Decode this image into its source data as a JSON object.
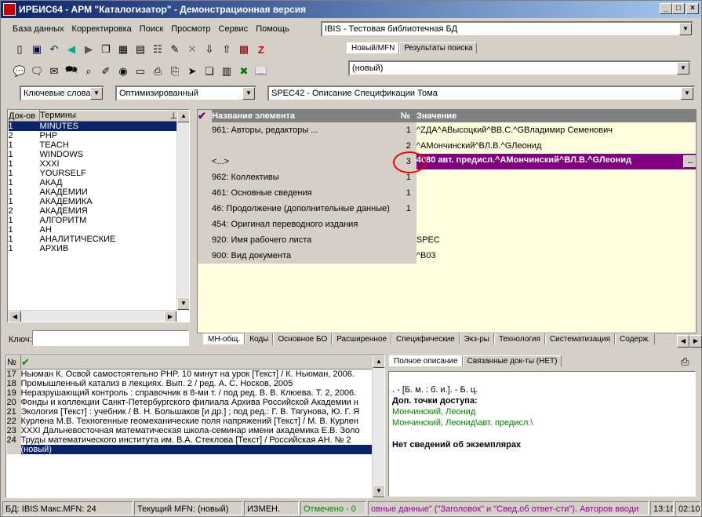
{
  "title": "ИРБИС64 - АРМ \"Каталогизатор\" - Демонстрационная версия",
  "menu": [
    "База данных",
    "Корректировка",
    "Поиск",
    "Просмотр",
    "Сервис",
    "Помощь"
  ],
  "db_combo": "IBIS - Тестовая библиотечная БД",
  "tabs_top": [
    "Новый/MFN",
    "Результаты поиска"
  ],
  "mfn_combo": "(новый)",
  "search_mode": "Ключевые слова",
  "search_opt": "Оптимизированный",
  "worksheet": "SPEC42 - Описание Спецификации Тома",
  "terms_headers": [
    "Док-ов",
    "Термины"
  ],
  "terms": [
    [
      "1",
      "MINUTES"
    ],
    [
      "2",
      "PHP"
    ],
    [
      "1",
      "TEACH"
    ],
    [
      "1",
      "WINDOWS"
    ],
    [
      "1",
      "XXXI"
    ],
    [
      "1",
      "YOURSELF"
    ],
    [
      "1",
      "АКАД"
    ],
    [
      "1",
      "АКАДЕМИИ"
    ],
    [
      "1",
      "АКАДЕМИКА"
    ],
    [
      "2",
      "АКАДЕМИЯ"
    ],
    [
      "1",
      "АЛГОРИТМ"
    ],
    [
      "1",
      "АН"
    ],
    [
      "1",
      "АНАЛИТИЧЕСКИЕ"
    ],
    [
      "1",
      "АРХИВ"
    ]
  ],
  "key_label": "Ключ:",
  "fields_headers": [
    "Название элемента",
    "№",
    "Значение"
  ],
  "fields": [
    [
      "961: Авторы, редакторы ...",
      "1",
      "^ZДА^AВысоцкий^BВ.С.^GВладимир Семенович"
    ],
    [
      "",
      "2",
      "^AМончинский^BЛ.В.^GЛеонид"
    ],
    [
      "<...>",
      "3",
      "4080 авт. предисл.^AМончинский^BЛ.В.^GЛеонид"
    ],
    [
      "962: Коллективы",
      "1",
      ""
    ],
    [
      "461: Основные сведения",
      "1",
      ""
    ],
    [
      "46: Продолжение (дополнительные данные)",
      "1",
      ""
    ],
    [
      "454: Оригинал переводного издания",
      "",
      ""
    ],
    [
      "920: Имя рабочего листа",
      "",
      "SPEC"
    ],
    [
      "900: Вид документа",
      "",
      "^B03"
    ]
  ],
  "bottom_tabs": [
    "МН-общ.",
    "Коды",
    "Основное БО",
    "Расширенное",
    "Специфические",
    "Экз-ры",
    "Технология",
    "Систематизация",
    "Содерж."
  ],
  "list_header": "№",
  "list": [
    [
      "17",
      "Ньюман К. Освой самостоятельно PHP. 10 минут на урок [Текст] / К. Ньюман, 2006."
    ],
    [
      "18",
      "Промышленный катализ в лекциях. Вып. 2 / ред. А. С. Носков, 2005"
    ],
    [
      "19",
      "Неразрушающий контроль : справочник в 8-ми т. / под ред. В. В. Клюева. Т. 2, 2006."
    ],
    [
      "20",
      "Фонды и коллекции Санкт-Петербургского филиала Архива Российской Академии н"
    ],
    [
      "21",
      "Экология [Текст] : учебник / В. Н. Большаков [и др.] ; под ред.: Г. В. Тягунова, Ю. Г. Я"
    ],
    [
      "22",
      "Курлена М.В. Техногенные геомеханические поля напряжений [Текст] / М. В. Курлен"
    ],
    [
      "23",
      "XXXI Дальневосточная математическая школа-семинар имени академика Е.В. Золо"
    ],
    [
      "24",
      "Труды математического института им. В.А. Стеклова [Текст] / Российская АН. № 2"
    ],
    [
      "",
      "(новый)"
    ]
  ],
  "desc_tabs": [
    "Полное описание",
    "Связанные док-ты (НЕТ)"
  ],
  "desc": {
    "l1": ". - [Б. м. : б. и.]. - Б. ц.",
    "l2": "Доп. точки доступа:",
    "l3": "Мончинский, Леонид",
    "l4": "Мончинский, Леонид\\авт. предисл.\\",
    "l5": "Нет сведений об экземплярах"
  },
  "status": {
    "db": "БД: IBIS Макс.MFN: 24",
    "mfn": "Текущий MFN: (новый)",
    "changed": "ИЗМЕН.",
    "marked": "Отмечено - 0",
    "msg": "овные данные\" (\"Заголовок\" и \"Свед.об ответ-сти\"). Авторов вводи",
    "time1": "13:18",
    "time2": "02:10"
  }
}
